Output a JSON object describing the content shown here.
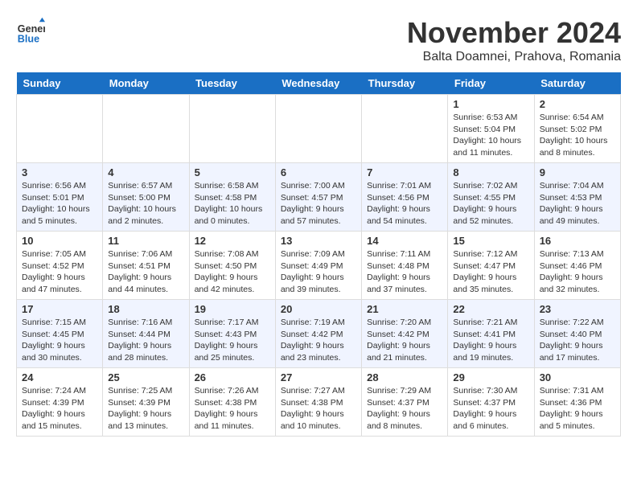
{
  "title": "November 2024",
  "location": "Balta Doamnei, Prahova, Romania",
  "logo": {
    "general": "General",
    "blue": "Blue"
  },
  "days_of_week": [
    "Sunday",
    "Monday",
    "Tuesday",
    "Wednesday",
    "Thursday",
    "Friday",
    "Saturday"
  ],
  "weeks": [
    [
      {
        "day": "",
        "info": ""
      },
      {
        "day": "",
        "info": ""
      },
      {
        "day": "",
        "info": ""
      },
      {
        "day": "",
        "info": ""
      },
      {
        "day": "",
        "info": ""
      },
      {
        "day": "1",
        "info": "Sunrise: 6:53 AM\nSunset: 5:04 PM\nDaylight: 10 hours and 11 minutes."
      },
      {
        "day": "2",
        "info": "Sunrise: 6:54 AM\nSunset: 5:02 PM\nDaylight: 10 hours and 8 minutes."
      }
    ],
    [
      {
        "day": "3",
        "info": "Sunrise: 6:56 AM\nSunset: 5:01 PM\nDaylight: 10 hours and 5 minutes."
      },
      {
        "day": "4",
        "info": "Sunrise: 6:57 AM\nSunset: 5:00 PM\nDaylight: 10 hours and 2 minutes."
      },
      {
        "day": "5",
        "info": "Sunrise: 6:58 AM\nSunset: 4:58 PM\nDaylight: 10 hours and 0 minutes."
      },
      {
        "day": "6",
        "info": "Sunrise: 7:00 AM\nSunset: 4:57 PM\nDaylight: 9 hours and 57 minutes."
      },
      {
        "day": "7",
        "info": "Sunrise: 7:01 AM\nSunset: 4:56 PM\nDaylight: 9 hours and 54 minutes."
      },
      {
        "day": "8",
        "info": "Sunrise: 7:02 AM\nSunset: 4:55 PM\nDaylight: 9 hours and 52 minutes."
      },
      {
        "day": "9",
        "info": "Sunrise: 7:04 AM\nSunset: 4:53 PM\nDaylight: 9 hours and 49 minutes."
      }
    ],
    [
      {
        "day": "10",
        "info": "Sunrise: 7:05 AM\nSunset: 4:52 PM\nDaylight: 9 hours and 47 minutes."
      },
      {
        "day": "11",
        "info": "Sunrise: 7:06 AM\nSunset: 4:51 PM\nDaylight: 9 hours and 44 minutes."
      },
      {
        "day": "12",
        "info": "Sunrise: 7:08 AM\nSunset: 4:50 PM\nDaylight: 9 hours and 42 minutes."
      },
      {
        "day": "13",
        "info": "Sunrise: 7:09 AM\nSunset: 4:49 PM\nDaylight: 9 hours and 39 minutes."
      },
      {
        "day": "14",
        "info": "Sunrise: 7:11 AM\nSunset: 4:48 PM\nDaylight: 9 hours and 37 minutes."
      },
      {
        "day": "15",
        "info": "Sunrise: 7:12 AM\nSunset: 4:47 PM\nDaylight: 9 hours and 35 minutes."
      },
      {
        "day": "16",
        "info": "Sunrise: 7:13 AM\nSunset: 4:46 PM\nDaylight: 9 hours and 32 minutes."
      }
    ],
    [
      {
        "day": "17",
        "info": "Sunrise: 7:15 AM\nSunset: 4:45 PM\nDaylight: 9 hours and 30 minutes."
      },
      {
        "day": "18",
        "info": "Sunrise: 7:16 AM\nSunset: 4:44 PM\nDaylight: 9 hours and 28 minutes."
      },
      {
        "day": "19",
        "info": "Sunrise: 7:17 AM\nSunset: 4:43 PM\nDaylight: 9 hours and 25 minutes."
      },
      {
        "day": "20",
        "info": "Sunrise: 7:19 AM\nSunset: 4:42 PM\nDaylight: 9 hours and 23 minutes."
      },
      {
        "day": "21",
        "info": "Sunrise: 7:20 AM\nSunset: 4:42 PM\nDaylight: 9 hours and 21 minutes."
      },
      {
        "day": "22",
        "info": "Sunrise: 7:21 AM\nSunset: 4:41 PM\nDaylight: 9 hours and 19 minutes."
      },
      {
        "day": "23",
        "info": "Sunrise: 7:22 AM\nSunset: 4:40 PM\nDaylight: 9 hours and 17 minutes."
      }
    ],
    [
      {
        "day": "24",
        "info": "Sunrise: 7:24 AM\nSunset: 4:39 PM\nDaylight: 9 hours and 15 minutes."
      },
      {
        "day": "25",
        "info": "Sunrise: 7:25 AM\nSunset: 4:39 PM\nDaylight: 9 hours and 13 minutes."
      },
      {
        "day": "26",
        "info": "Sunrise: 7:26 AM\nSunset: 4:38 PM\nDaylight: 9 hours and 11 minutes."
      },
      {
        "day": "27",
        "info": "Sunrise: 7:27 AM\nSunset: 4:38 PM\nDaylight: 9 hours and 10 minutes."
      },
      {
        "day": "28",
        "info": "Sunrise: 7:29 AM\nSunset: 4:37 PM\nDaylight: 9 hours and 8 minutes."
      },
      {
        "day": "29",
        "info": "Sunrise: 7:30 AM\nSunset: 4:37 PM\nDaylight: 9 hours and 6 minutes."
      },
      {
        "day": "30",
        "info": "Sunrise: 7:31 AM\nSunset: 4:36 PM\nDaylight: 9 hours and 5 minutes."
      }
    ]
  ]
}
